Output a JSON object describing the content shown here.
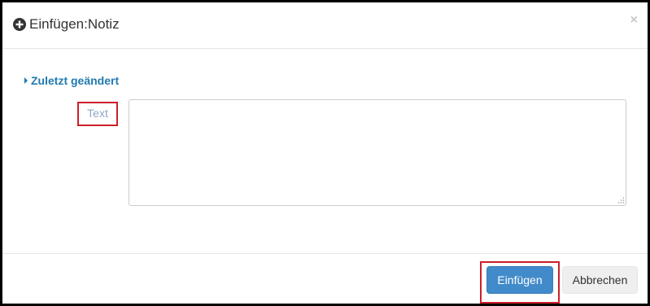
{
  "dialog": {
    "title": "Einfügen:Notiz",
    "close_symbol": "×",
    "title_icon": "plus-circle-icon"
  },
  "section": {
    "toggle_label": "Zuletzt geändert",
    "toggle_icon": "caret-right-icon",
    "expanded": false
  },
  "form": {
    "text_label": "Text",
    "text_value": ""
  },
  "footer": {
    "insert_label": "Einfügen",
    "cancel_label": "Abbrechen"
  },
  "colors": {
    "primary_button": "#428bca",
    "link": "#1f7ab0",
    "highlight_box": "#cc1f2a",
    "label_text": "#8ea8c0"
  }
}
